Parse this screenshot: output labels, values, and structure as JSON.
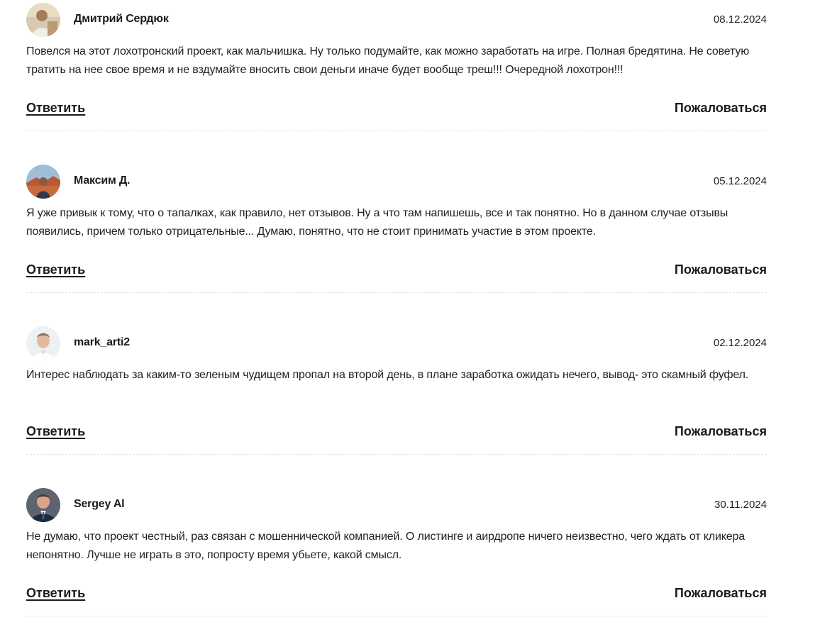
{
  "comments": [
    {
      "author": "Дмитрий Сердюк",
      "date": "08.12.2024",
      "text": "Повелся на этот лохотронский проект, как мальчишка. Ну только подумайте, как можно заработать на игре. Полная бредятина. Не советую тратить на нее свое время и не вздумайте вносить свои деньги иначе будет вообще треш!!! Очередной лохотрон!!!",
      "reply_label": "Ответить",
      "report_label": "Пожаловаться"
    },
    {
      "author": "Максим Д.",
      "date": "05.12.2024",
      "text": "Я уже привык к тому, что о тапалках, как правило, нет отзывов. Ну а что там напишешь, все и так понятно. Но в данном случае отзывы появились, причем только отрицательные... Думаю, понятно, что не стоит принимать участие в этом проекте.",
      "reply_label": "Ответить",
      "report_label": "Пожаловаться"
    },
    {
      "author": "mark_arti2",
      "date": "02.12.2024",
      "text": "Интерес наблюдать за каким-то зеленым чудищем пропал на второй день, в плане заработка ожидать нечего, вывод- это скамный фуфел.",
      "reply_label": "Ответить",
      "report_label": "Пожаловаться"
    },
    {
      "author": "Sergey Al",
      "date": "30.11.2024",
      "text": "Не думаю, что проект честный, раз связан с мошеннической компанией. О листинге и аирдропе ничего неизвестно, чего ждать от кликера непонятно. Лучше не играть в это, попросту время убьете, какой смысл.",
      "reply_label": "Ответить",
      "report_label": "Пожаловаться"
    }
  ],
  "colors": {
    "text": "#222222",
    "divider": "#e2e2e2",
    "background": "#ffffff"
  }
}
